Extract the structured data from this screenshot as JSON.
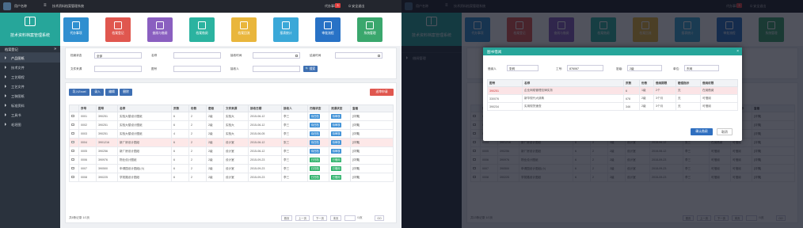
{
  "app": {
    "user": "用户名称",
    "title": "技术资料档案管理系统",
    "todo": "代办事项",
    "todo_count": "3",
    "logout": "安全退出",
    "brand": "技术资料档案管理系统"
  },
  "tiles": [
    {
      "label": "代办事项",
      "color": "#2f8fd0"
    },
    {
      "label": "档案登记",
      "color": "#e0574f"
    },
    {
      "label": "查阅与借阅",
      "color": "#8a5fc0"
    },
    {
      "label": "档案借阅",
      "color": "#2bb3a0"
    },
    {
      "label": "档案回流",
      "color": "#e9b63c"
    },
    {
      "label": "报表统计",
      "color": "#3aa8d8"
    },
    {
      "label": "审批流程",
      "color": "#2872c6"
    },
    {
      "label": "系统管理",
      "color": "#3aa76d"
    }
  ],
  "sidebar": {
    "header": "档案登记",
    "collapse": "»",
    "items": [
      "产品图纸",
      "技术文件",
      "工艺规程",
      "工艺文件",
      "工装图纸",
      "标准资料",
      "工具书",
      "毛坯图"
    ]
  },
  "filter": {
    "status_label": "档案状态",
    "status_value": "全部",
    "name_label": "名称",
    "date_label": "接收时间",
    "end_label": "结束时间",
    "source_label": "文件来源",
    "code_label": "图号",
    "receiver_label": "接收人",
    "search_btn": "搜索"
  },
  "toolbar": {
    "export": "导入Excel",
    "import": "录入",
    "edit": "编辑",
    "delete": "删除",
    "submit": "送审申请"
  },
  "table": {
    "headers": [
      "",
      "序号",
      "图号",
      "名称",
      "页数",
      "份数",
      "密级",
      "文件来源",
      "接收日期",
      "接收人",
      "归档状态",
      "流通状态",
      "查看"
    ],
    "rows": [
      {
        "no": "0001",
        "code": "390251",
        "name": "实验大楼设计图纸",
        "pages": "6",
        "copies": "2",
        "level": "2级",
        "source": "实验大",
        "date": "2015-06-12",
        "receiver": "李三",
        "archive": "待归档",
        "flow": "待审核",
        "view": "[详情]",
        "hl": false
      },
      {
        "no": "0002",
        "code": "390251",
        "name": "实验大楼设计图纸",
        "pages": "6",
        "copies": "2",
        "level": "2级",
        "source": "实验大",
        "date": "2015-06-12",
        "receiver": "李三",
        "archive": "待归档",
        "flow": "待审核",
        "view": "[详情]",
        "hl": false
      },
      {
        "no": "0003",
        "code": "390251",
        "name": "实验大楼设计图纸",
        "pages": "4",
        "copies": "2",
        "level": "2级",
        "source": "实验大",
        "date": "2015-06-05",
        "receiver": "李三",
        "archive": "待归档",
        "flow": "待审核",
        "view": "[详情]",
        "hl": false
      },
      {
        "no": "0004",
        "code": "3901216",
        "name": "新厂房设计图纸",
        "pages": "6",
        "copies": "2",
        "level": "2级",
        "source": "设计室",
        "date": "2015-06-12",
        "receiver": "张三",
        "archive": "待归档",
        "flow": "待审核",
        "view": "[详情]",
        "hl": true
      },
      {
        "no": "0005",
        "code": "390256",
        "name": "新厂房设计图纸",
        "pages": "6",
        "copies": "2",
        "level": "2级",
        "source": "设计室",
        "date": "2015-06-12",
        "receiver": "李三",
        "archive": "待归档",
        "flow": "待审核",
        "view": "[详情]",
        "hl": false
      },
      {
        "no": "0006",
        "code": "390976",
        "name": "物业设计图纸",
        "pages": "6",
        "copies": "2",
        "level": "2级",
        "source": "设计室",
        "date": "2015-09-23",
        "receiver": "李三",
        "archive": "已归档",
        "flow": "已借用",
        "view": "[详情]",
        "hl": false
      },
      {
        "no": "0007",
        "code": "390500",
        "name": "申请园设计图纸(小)",
        "pages": "6",
        "copies": "2",
        "level": "2级",
        "source": "设计室",
        "date": "2015-09-23",
        "receiver": "李三",
        "archive": "已归档",
        "flow": "已借用",
        "view": "[详情]",
        "hl": false,
        "warn": true
      },
      {
        "no": "0008",
        "code": "390225",
        "name": "学苑路设计图纸",
        "pages": "6",
        "copies": "2",
        "level": "2级",
        "source": "设计室",
        "date": "2015-09-23",
        "receiver": "李三",
        "archive": "已归档",
        "flow": "已借用",
        "view": "[详情]",
        "hl": false
      }
    ]
  },
  "pager": {
    "summary": "共6条记录 1/1页",
    "first": "首页",
    "prev": "上一页",
    "next": "下一页",
    "last": "末页",
    "unit": "/1页",
    "go": "GO"
  },
  "modal": {
    "title": "图书借阅",
    "close": "×",
    "borrower_label": "借阅人",
    "borrower_value": "张莉",
    "empno_label": "工号",
    "empno_value": "876067",
    "level_label": "密级",
    "level_value": "2级",
    "dept_label": "单位",
    "dept_value": "东网",
    "headers": [
      "图号",
      "名称",
      "页数",
      "份数",
      "借阅期限",
      "赔偿指示",
      "借阅权限"
    ],
    "rows": [
      {
        "code": "390251",
        "name": "企业网络管理法律实务",
        "pages": "6",
        "copies": "1级",
        "term": "2个",
        "comp": "无",
        "perm": "在阅借阅",
        "sel": true
      },
      {
        "code": "330076",
        "name": "新华现代大辞典",
        "pages": "678",
        "copies": "2级",
        "term": "3个月",
        "comp": "无",
        "perm": "可借阅",
        "sel": false
      },
      {
        "code": "390234",
        "name": "实用现货速查",
        "pages": "346",
        "copies": "2级",
        "term": "3个月",
        "comp": "无",
        "perm": "可借阅",
        "sel": false
      }
    ],
    "confirm": "确认借阅",
    "cancel": "取消"
  },
  "bg2": {
    "breadcrumb": "借阅管理",
    "col_a": "借阅权限",
    "col_b": "赔偿指示",
    "cell_a": "可借阅",
    "cell_b": "可借阅",
    "hl_a": "在阅借阅",
    "summary": "共13条记录 1/1页"
  }
}
